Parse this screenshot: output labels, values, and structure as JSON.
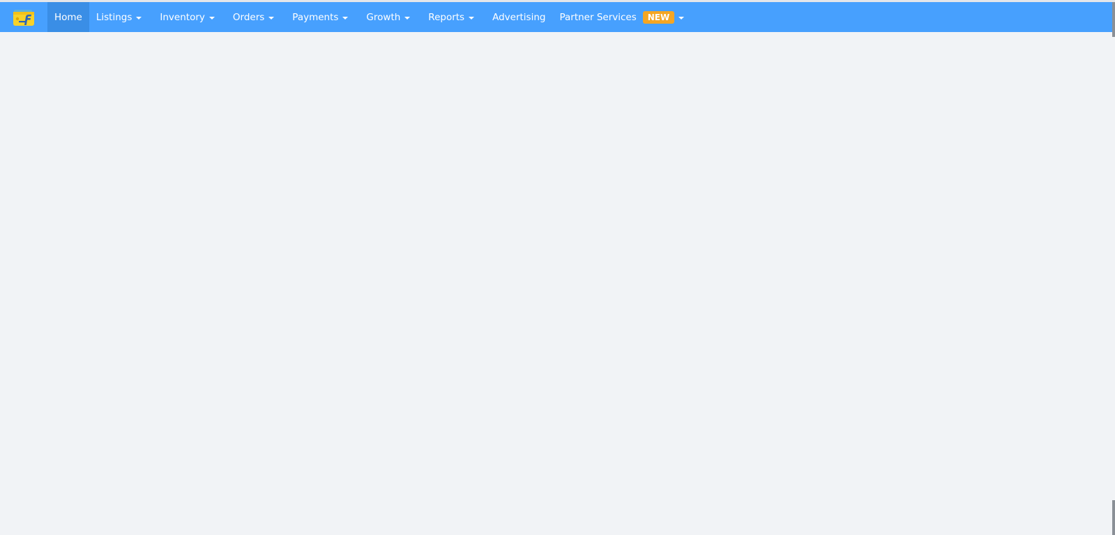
{
  "navbar": {
    "logo_icon": "flipkart-seller-wallet-logo",
    "items": [
      {
        "label": "Home",
        "dropdown": false,
        "active": true
      },
      {
        "label": "Listings",
        "dropdown": true
      },
      {
        "label": "Inventory",
        "dropdown": true
      },
      {
        "label": "Orders",
        "dropdown": true
      },
      {
        "label": "Payments",
        "dropdown": true
      },
      {
        "label": "Growth",
        "dropdown": true
      },
      {
        "label": "Reports",
        "dropdown": true
      },
      {
        "label": "Advertising",
        "dropdown": false
      },
      {
        "label": "Partner Services",
        "dropdown": true,
        "badge": "NEW"
      }
    ]
  },
  "colors": {
    "nav_bg": "#47a0fe",
    "nav_active_bg": "#3a8ee6",
    "badge_bg": "#f5a623",
    "page_bg": "#f1f3f6"
  }
}
